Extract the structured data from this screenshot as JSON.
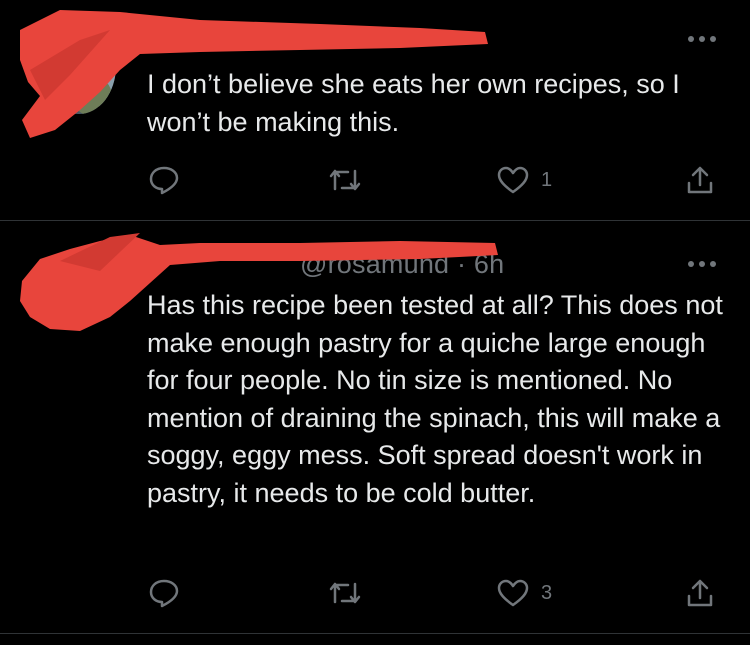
{
  "replies": [
    {
      "timestamp": "",
      "text": "I don’t believe she eats her own recipes, so I won’t be making this.",
      "actions": {
        "reply_icon": "reply-icon",
        "repost_icon": "repost-icon",
        "like_icon": "heart-icon",
        "like_count": "1",
        "share_icon": "share-icon"
      }
    },
    {
      "header_visible": "@rosamund · 6h",
      "text": "Has this recipe been tested at all? This does not make enough pastry for a quiche large enough for four people. No tin size is mentioned. No mention of draining the spinach, this will make a soggy, eggy mess. Soft spread doesn't work in pastry, it needs to be cold butter.",
      "actions": {
        "reply_icon": "reply-icon",
        "repost_icon": "repost-icon",
        "like_icon": "heart-icon",
        "like_count": "3",
        "share_icon": "share-icon"
      }
    }
  ],
  "colors": {
    "background": "#000000",
    "text": "#e7e9ea",
    "muted": "#71767b",
    "divider": "#2f3336",
    "redaction": "#e8453c"
  }
}
